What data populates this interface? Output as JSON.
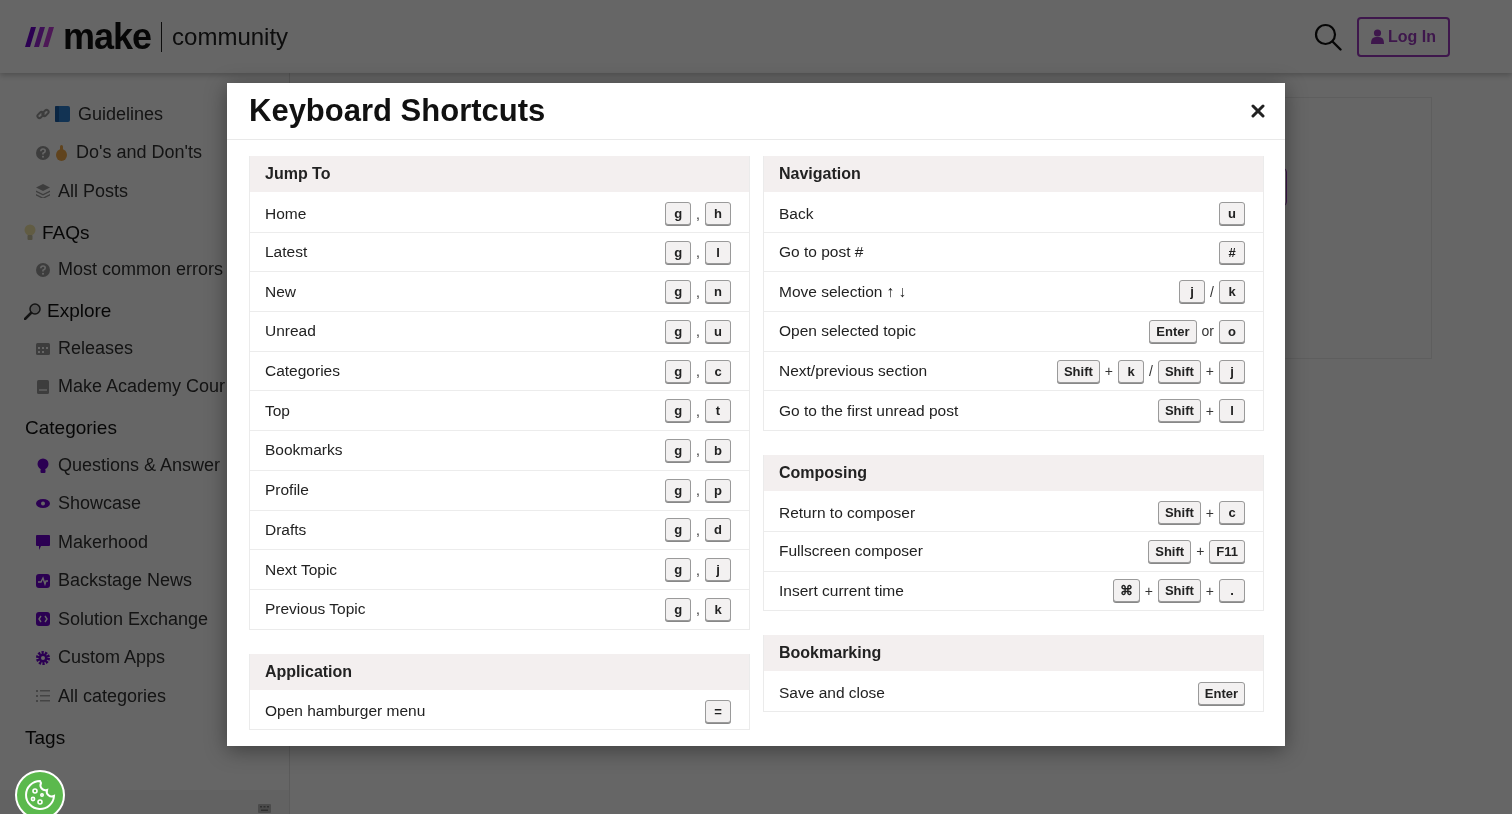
{
  "header": {
    "logo_word": "make",
    "site": "community",
    "login": "Log In"
  },
  "sidebar": {
    "sections": [
      {
        "items": [
          "Guidelines",
          "Do's and Don'ts",
          "All Posts"
        ]
      },
      {
        "heading": "FAQs",
        "items": [
          "Most common errors"
        ]
      },
      {
        "heading": "Explore",
        "items": [
          "Releases",
          "Make Academy Cour"
        ]
      },
      {
        "heading": "Categories",
        "items": [
          "Questions & Answer",
          "Showcase",
          "Makerhood",
          "Backstage News",
          "Solution Exchange",
          "Custom Apps",
          "All categories"
        ]
      },
      {
        "heading": "Tags"
      }
    ]
  },
  "modal": {
    "title": "Keyboard Shortcuts",
    "columns": [
      [
        {
          "title": "Jump To",
          "rows": [
            {
              "label": "Home",
              "keys": [
                {
                  "kind": "key",
                  "text": "g"
                },
                {
                  "kind": "sep",
                  "text": ","
                },
                {
                  "kind": "key",
                  "text": "h"
                }
              ]
            },
            {
              "label": "Latest",
              "keys": [
                {
                  "kind": "key",
                  "text": "g"
                },
                {
                  "kind": "sep",
                  "text": ","
                },
                {
                  "kind": "key",
                  "text": "l"
                }
              ]
            },
            {
              "label": "New",
              "keys": [
                {
                  "kind": "key",
                  "text": "g"
                },
                {
                  "kind": "sep",
                  "text": ","
                },
                {
                  "kind": "key",
                  "text": "n"
                }
              ]
            },
            {
              "label": "Unread",
              "keys": [
                {
                  "kind": "key",
                  "text": "g"
                },
                {
                  "kind": "sep",
                  "text": ","
                },
                {
                  "kind": "key",
                  "text": "u"
                }
              ]
            },
            {
              "label": "Categories",
              "keys": [
                {
                  "kind": "key",
                  "text": "g"
                },
                {
                  "kind": "sep",
                  "text": ","
                },
                {
                  "kind": "key",
                  "text": "c"
                }
              ]
            },
            {
              "label": "Top",
              "keys": [
                {
                  "kind": "key",
                  "text": "g"
                },
                {
                  "kind": "sep",
                  "text": ","
                },
                {
                  "kind": "key",
                  "text": "t"
                }
              ]
            },
            {
              "label": "Bookmarks",
              "keys": [
                {
                  "kind": "key",
                  "text": "g"
                },
                {
                  "kind": "sep",
                  "text": ","
                },
                {
                  "kind": "key",
                  "text": "b"
                }
              ]
            },
            {
              "label": "Profile",
              "keys": [
                {
                  "kind": "key",
                  "text": "g"
                },
                {
                  "kind": "sep",
                  "text": ","
                },
                {
                  "kind": "key",
                  "text": "p"
                }
              ]
            },
            {
              "label": "Drafts",
              "keys": [
                {
                  "kind": "key",
                  "text": "g"
                },
                {
                  "kind": "sep",
                  "text": ","
                },
                {
                  "kind": "key",
                  "text": "d"
                }
              ]
            },
            {
              "label": "Next Topic",
              "keys": [
                {
                  "kind": "key",
                  "text": "g"
                },
                {
                  "kind": "sep",
                  "text": ","
                },
                {
                  "kind": "key",
                  "text": "j"
                }
              ]
            },
            {
              "label": "Previous Topic",
              "keys": [
                {
                  "kind": "key",
                  "text": "g"
                },
                {
                  "kind": "sep",
                  "text": ","
                },
                {
                  "kind": "key",
                  "text": "k"
                }
              ]
            }
          ]
        },
        {
          "title": "Application",
          "rows": [
            {
              "label": "Open hamburger menu",
              "keys": [
                {
                  "kind": "key",
                  "text": "="
                }
              ]
            }
          ]
        }
      ],
      [
        {
          "title": "Navigation",
          "rows": [
            {
              "label": "Back",
              "keys": [
                {
                  "kind": "key",
                  "text": "u"
                }
              ]
            },
            {
              "label": "Go to post #",
              "keys": [
                {
                  "kind": "key",
                  "text": "#"
                }
              ]
            },
            {
              "label": "Move selection ↑ ↓",
              "keys": [
                {
                  "kind": "key",
                  "text": "j"
                },
                {
                  "kind": "sep",
                  "text": "/"
                },
                {
                  "kind": "key",
                  "text": "k"
                }
              ]
            },
            {
              "label": "Open selected topic",
              "keys": [
                {
                  "kind": "key",
                  "text": "Enter"
                },
                {
                  "kind": "sep",
                  "text": "or"
                },
                {
                  "kind": "key",
                  "text": "o"
                }
              ]
            },
            {
              "label": "Next/previous section",
              "keys": [
                {
                  "kind": "key",
                  "text": "Shift"
                },
                {
                  "kind": "sep",
                  "text": "+"
                },
                {
                  "kind": "key",
                  "text": "k"
                },
                {
                  "kind": "sep",
                  "text": "/"
                },
                {
                  "kind": "key",
                  "text": "Shift"
                },
                {
                  "kind": "sep",
                  "text": "+"
                },
                {
                  "kind": "key",
                  "text": "j"
                }
              ]
            },
            {
              "label": "Go to the first unread post",
              "keys": [
                {
                  "kind": "key",
                  "text": "Shift"
                },
                {
                  "kind": "sep",
                  "text": "+"
                },
                {
                  "kind": "key",
                  "text": "l"
                }
              ]
            }
          ]
        },
        {
          "title": "Composing",
          "rows": [
            {
              "label": "Return to composer",
              "keys": [
                {
                  "kind": "key",
                  "text": "Shift"
                },
                {
                  "kind": "sep",
                  "text": "+"
                },
                {
                  "kind": "key",
                  "text": "c"
                }
              ]
            },
            {
              "label": "Fullscreen composer",
              "keys": [
                {
                  "kind": "key",
                  "text": "Shift"
                },
                {
                  "kind": "sep",
                  "text": "+"
                },
                {
                  "kind": "key",
                  "text": "F11"
                }
              ]
            },
            {
              "label": "Insert current time",
              "keys": [
                {
                  "kind": "key",
                  "text": "⌘"
                },
                {
                  "kind": "sep",
                  "text": "+"
                },
                {
                  "kind": "key",
                  "text": "Shift"
                },
                {
                  "kind": "sep",
                  "text": "+"
                },
                {
                  "kind": "key",
                  "text": "."
                }
              ]
            }
          ]
        },
        {
          "title": "Bookmarking",
          "rows": [
            {
              "label": "Save and close",
              "keys": [
                {
                  "kind": "key",
                  "text": "Enter"
                }
              ]
            }
          ]
        }
      ]
    ]
  }
}
